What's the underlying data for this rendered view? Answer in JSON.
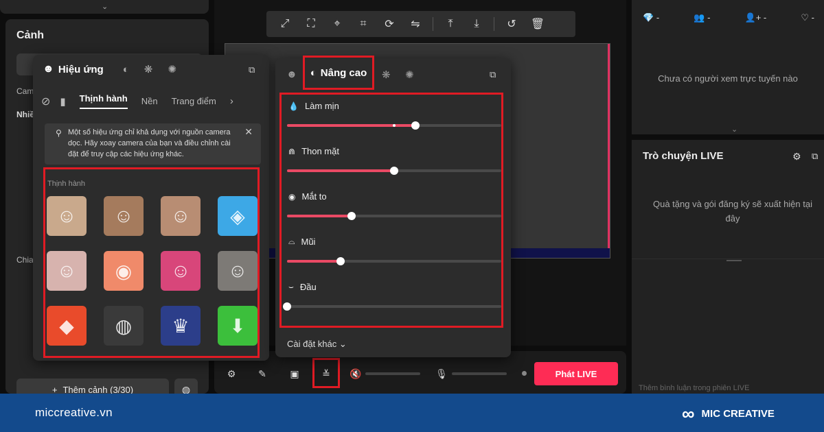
{
  "left_panel": {
    "scene_title": "Cảnh",
    "label_camera": "Cam",
    "label_multi": "Nhiề",
    "label_share": "Chia",
    "add_scene": "Thêm cảnh (3/30)"
  },
  "effects_panel": {
    "title": "Hiệu ứng",
    "tabs": [
      "Thịnh hành",
      "Nền",
      "Trang điểm"
    ],
    "notice": "Một số hiệu ứng chỉ khả dụng với nguồn camera dọc. Hãy xoay camera của bạn và điều chỉnh cài đặt để truy cập các hiệu ứng khác.",
    "section_title": "Thịnh hành",
    "thumbnails": [
      "woman-portrait",
      "man-portrait",
      "woman-portrait-2",
      "white-fox-mask",
      "girl-portrait",
      "cartoon-pig",
      "colorful-hat-woman",
      "face-paint-man",
      "dinosaur-hood",
      "gingerbread",
      "royal-crown",
      "photo-download"
    ]
  },
  "advanced_panel": {
    "title": "Nâng cao",
    "sliders": [
      {
        "label": "Làm mịn",
        "icon": "drop-icon",
        "value": 0.6,
        "default": 0.5
      },
      {
        "label": "Thon mặt",
        "icon": "face-slim-icon",
        "value": 0.5
      },
      {
        "label": "Mắt to",
        "icon": "eye-icon",
        "value": 0.3
      },
      {
        "label": "Mũi",
        "icon": "nose-icon",
        "value": 0.25
      },
      {
        "label": "Đầu",
        "icon": "head-icon",
        "value": 0.0
      }
    ],
    "more_settings": "Cài đặt khác"
  },
  "bottom_bar": {
    "go_live": "Phát LIVE"
  },
  "right_panel": {
    "stats": [
      "-",
      "-",
      "-",
      "-"
    ],
    "viewers_empty": "Chưa có người xem trực tuyến nào",
    "chat_title": "Trò chuyện LIVE",
    "chat_message": "Quà tặng và gói đăng ký sẽ xuất hiện tại đây",
    "chat_placeholder": "Thêm bình luận trong phiên LIVE"
  },
  "footer": {
    "website": "miccreative.vn",
    "brand": "MIC CREATIVE"
  },
  "colors": {
    "accent": "#fe2c55",
    "highlight": "#e01b24",
    "footer": "#134a8c"
  }
}
